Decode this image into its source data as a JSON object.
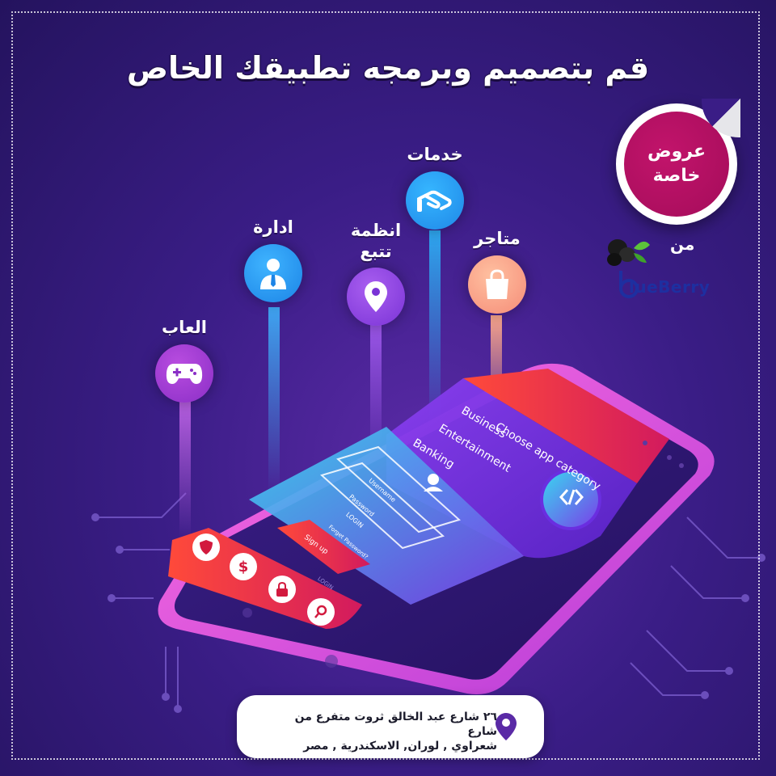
{
  "headline": "قم بتصميم وبرمجه تطبيقك الخاص",
  "categories": {
    "games": "العاب",
    "management": "ادارة",
    "tracking_line1": "انظمة",
    "tracking_line2": "تتبع",
    "services": "خدمات",
    "stores": "متاجر"
  },
  "sticker": {
    "line1": "عروض",
    "line2": "خاصة"
  },
  "from_label": "من",
  "brand": {
    "text": "lueBerry",
    "initial": "b"
  },
  "phone_screen": {
    "menu_title": "Choose app category",
    "menu_items": [
      "Business",
      "Entertainment",
      "Banking"
    ],
    "login_fields": [
      "Username",
      "Password"
    ],
    "login_button": "LOGIN",
    "forgot": "Forget Password?",
    "signup": "Sign up",
    "login_footer": "LOGIN"
  },
  "address": {
    "line1": "٢٦ شارع عبد الخالق ثروت متفرع من شارع",
    "line2": "شعراوي , لوران, الاسكندرية , مصر"
  },
  "colors": {
    "background": "#3a1d86",
    "sticker": "#b2105f",
    "phone_frame": "#e04bd0",
    "brand": "#1e2fa0"
  },
  "icons": [
    "gamepad-icon",
    "user-tie-icon",
    "location-pin-icon",
    "hand-icon",
    "shopping-bag-icon",
    "shield-icon",
    "dollar-icon",
    "lock-icon",
    "search-icon",
    "code-icon",
    "map-pin-icon"
  ]
}
